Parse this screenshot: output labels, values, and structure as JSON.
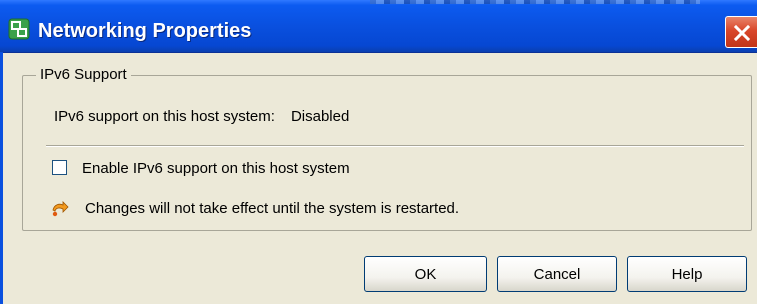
{
  "window": {
    "title": "Networking Properties",
    "title_icon": "network-properties-icon",
    "close_icon": "close-icon"
  },
  "group": {
    "legend": "IPv6 Support",
    "status_label": "IPv6 support on this host system:",
    "status_value": "Disabled",
    "checkbox_label": "Enable IPv6 support on this host system",
    "checkbox_checked": false,
    "note_icon": "warning-arrow-icon",
    "note_text": "Changes will not take effect until the system is restarted."
  },
  "buttons": {
    "ok": "OK",
    "cancel": "Cancel",
    "help": "Help"
  },
  "colors": {
    "titlebar": "#0a50df",
    "close_button": "#d9472a",
    "dialog_background": "#ece9d8"
  }
}
